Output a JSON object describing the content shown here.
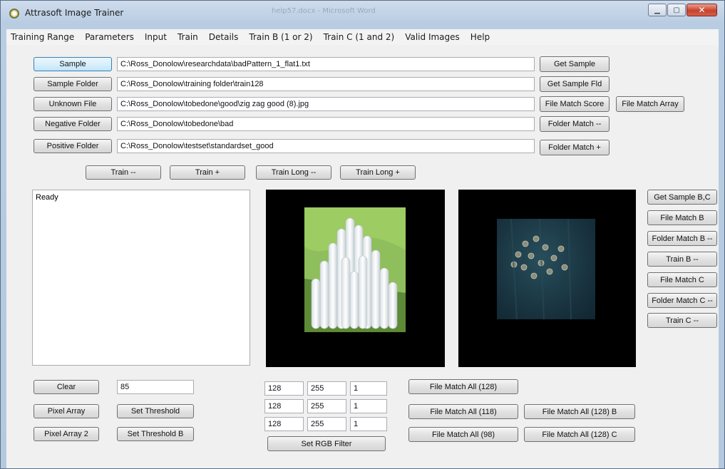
{
  "window": {
    "title": "Attrasoft Image Trainer",
    "background_title": "help57.docx - Microsoft Word",
    "minimize_glyph": "▁",
    "maximize_glyph": "▢",
    "close_glyph": "✕"
  },
  "menu": [
    "Training Range",
    "Parameters",
    "Input",
    "Train",
    "Details",
    "Train B (1 or 2)",
    "Train C (1 and 2)",
    "Valid Images",
    "Help"
  ],
  "rows": {
    "sample": {
      "button": "Sample",
      "path": "C:\\Ross_Donolow\\researchdata\\badPattern_1_flat1.txt",
      "action": "Get Sample"
    },
    "sample_folder": {
      "button": "Sample Folder",
      "path": "C:\\Ross_Donolow\\training folder\\train128",
      "action": "Get Sample Fld"
    },
    "unknown_file": {
      "button": "Unknown File",
      "path": "C:\\Ross_Donolow\\tobedone\\good\\zig zag  good  (8).jpg",
      "action": "File Match Score",
      "action2": "File Match Array"
    },
    "negative_folder": {
      "button": "Negative Folder",
      "path": "C:\\Ross_Donolow\\tobedone\\bad",
      "action": "Folder Match --"
    },
    "positive_folder": {
      "button": "Positive Folder",
      "path": "C:\\Ross_Donolow\\testset\\standardset_good",
      "action": "Folder Match +"
    }
  },
  "train_buttons": {
    "train_minus": "Train --",
    "train_plus": "Train +",
    "train_long_minus": "Train Long --",
    "train_long_plus": "Train Long +"
  },
  "status_text": "Ready",
  "side_buttons": [
    "Get Sample B,C",
    "File Match B",
    "Folder Match B --",
    "Train B --",
    "File Match C",
    "Folder Match C --",
    "Train C --"
  ],
  "bottom_left": {
    "clear": "Clear",
    "threshold_value": "85",
    "pixel_array": "Pixel Array",
    "set_threshold": "Set Threshold",
    "pixel_array_2": "Pixel Array 2",
    "set_threshold_b": "Set Threshold B"
  },
  "rgb_filter": {
    "rows": [
      [
        "128",
        "255",
        "1"
      ],
      [
        "128",
        "255",
        "1"
      ],
      [
        "128",
        "255",
        "1"
      ]
    ],
    "button": "Set RGB Filter"
  },
  "file_match": {
    "all_128": "File Match All (128)",
    "all_118": "File Match All (118)",
    "all_98": "File Match All (98)",
    "all_128_b": "File Match All (128) B",
    "all_128_c": "File Match All (128) C"
  },
  "colors": {
    "selected_button": "#d9f0fc",
    "client_bg": "#f0f0f0",
    "panel_bg": "#000000"
  }
}
